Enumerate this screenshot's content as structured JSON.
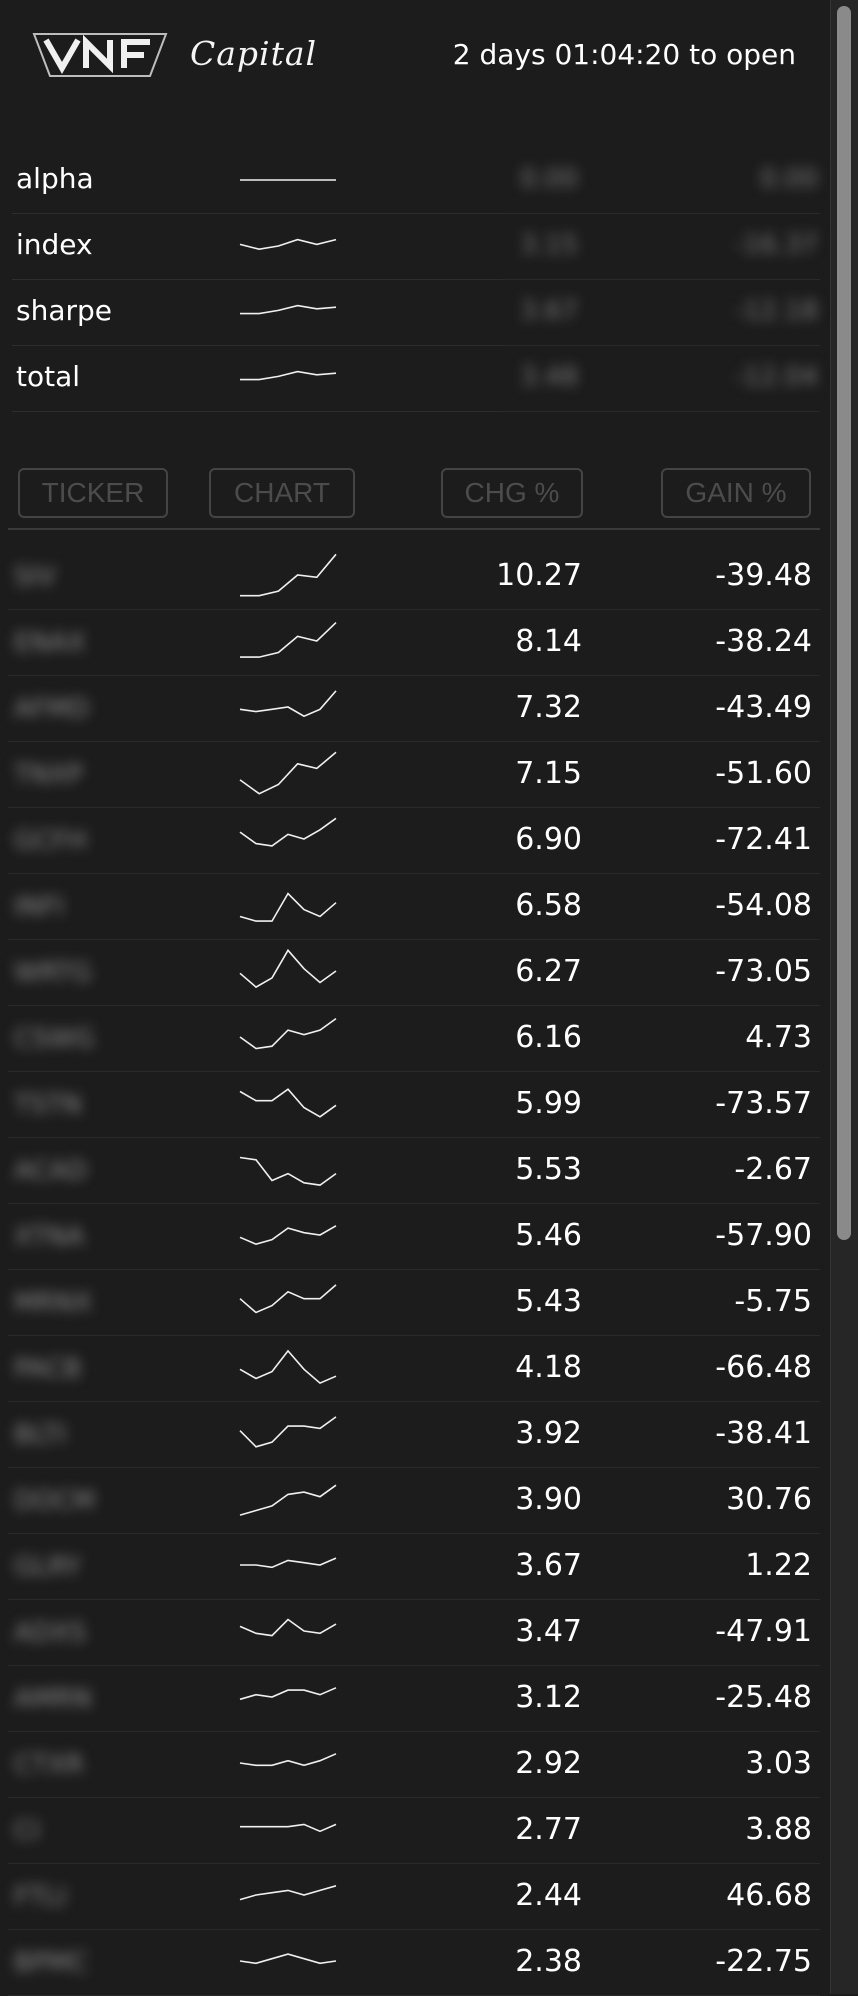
{
  "header": {
    "logo_text": "VNF",
    "logo_script": "Capital",
    "countdown": "2 days 01:04:20 to open"
  },
  "summary": [
    {
      "label": "alpha",
      "value": "0.00",
      "gain": "0.00",
      "spark": [
        0.5,
        0.5,
        0.5,
        0.5,
        0.5,
        0.5
      ]
    },
    {
      "label": "index",
      "value": "3.15",
      "gain": "-16.37",
      "spark": [
        0.45,
        0.6,
        0.5,
        0.3,
        0.45,
        0.3
      ]
    },
    {
      "label": "sharpe",
      "value": "3.67",
      "gain": "-12.18",
      "spark": [
        0.55,
        0.55,
        0.45,
        0.3,
        0.4,
        0.35
      ]
    },
    {
      "label": "total",
      "value": "3.48",
      "gain": "-12.04",
      "spark": [
        0.55,
        0.55,
        0.45,
        0.3,
        0.4,
        0.35
      ]
    }
  ],
  "table": {
    "headers": {
      "ticker": "TICKER",
      "chart": "CHART",
      "chg": "CHG %",
      "gain": "GAIN %"
    },
    "rows": [
      {
        "ticker": "SIV",
        "chg": "10.27",
        "gain": "-39.48",
        "spark": [
          0.95,
          0.95,
          0.85,
          0.5,
          0.55,
          0.05
        ]
      },
      {
        "ticker": "ENAX",
        "chg": "8.14",
        "gain": "-38.24",
        "spark": [
          0.85,
          0.85,
          0.75,
          0.4,
          0.5,
          0.1
        ]
      },
      {
        "ticker": "AFMD",
        "chg": "7.32",
        "gain": "-43.49",
        "spark": [
          0.55,
          0.6,
          0.55,
          0.5,
          0.7,
          0.55,
          0.15
        ]
      },
      {
        "ticker": "TNXP",
        "chg": "7.15",
        "gain": "-51.60",
        "spark": [
          0.65,
          0.95,
          0.75,
          0.3,
          0.4,
          0.05
        ]
      },
      {
        "ticker": "GCFH",
        "chg": "6.90",
        "gain": "-72.41",
        "spark": [
          0.35,
          0.6,
          0.65,
          0.4,
          0.5,
          0.3,
          0.05
        ]
      },
      {
        "ticker": "INFI",
        "chg": "6.58",
        "gain": "-54.08",
        "spark": [
          0.75,
          0.85,
          0.85,
          0.25,
          0.6,
          0.75,
          0.45
        ]
      },
      {
        "ticker": "WRTG",
        "chg": "6.27",
        "gain": "-73.05",
        "spark": [
          0.55,
          0.85,
          0.65,
          0.05,
          0.45,
          0.75,
          0.5
        ]
      },
      {
        "ticker": "CSWG",
        "chg": "6.16",
        "gain": "4.73",
        "spark": [
          0.5,
          0.75,
          0.7,
          0.35,
          0.45,
          0.35,
          0.1
        ]
      },
      {
        "ticker": "TSTN",
        "chg": "5.99",
        "gain": "-73.57",
        "spark": [
          0.25,
          0.45,
          0.45,
          0.2,
          0.6,
          0.8,
          0.55
        ]
      },
      {
        "ticker": "ACAD",
        "chg": "5.53",
        "gain": "-2.67",
        "spark": [
          0.25,
          0.3,
          0.75,
          0.6,
          0.8,
          0.85,
          0.6
        ]
      },
      {
        "ticker": "XTNA",
        "chg": "5.46",
        "gain": "-57.90",
        "spark": [
          0.55,
          0.7,
          0.6,
          0.35,
          0.45,
          0.5,
          0.3
        ]
      },
      {
        "ticker": "MRNX",
        "chg": "5.43",
        "gain": "-5.75",
        "spark": [
          0.45,
          0.75,
          0.6,
          0.3,
          0.45,
          0.45,
          0.15
        ]
      },
      {
        "ticker": "PACB",
        "chg": "4.18",
        "gain": "-66.48",
        "spark": [
          0.55,
          0.75,
          0.6,
          0.15,
          0.55,
          0.85,
          0.7
        ]
      },
      {
        "ticker": "BLTI",
        "chg": "3.92",
        "gain": "-38.41",
        "spark": [
          0.45,
          0.8,
          0.7,
          0.35,
          0.35,
          0.4,
          0.15
        ]
      },
      {
        "ticker": "DOCM",
        "chg": "3.90",
        "gain": "30.76",
        "spark": [
          0.85,
          0.75,
          0.65,
          0.4,
          0.35,
          0.45,
          0.2
        ]
      },
      {
        "ticker": "GLRY",
        "chg": "3.67",
        "gain": "1.22",
        "spark": [
          0.5,
          0.5,
          0.55,
          0.4,
          0.45,
          0.5,
          0.35
        ]
      },
      {
        "ticker": "ADXS",
        "chg": "3.47",
        "gain": "-47.91",
        "spark": [
          0.4,
          0.55,
          0.6,
          0.25,
          0.5,
          0.55,
          0.35
        ]
      },
      {
        "ticker": "AMRN",
        "chg": "3.12",
        "gain": "-25.48",
        "spark": [
          0.55,
          0.45,
          0.5,
          0.35,
          0.35,
          0.45,
          0.3
        ]
      },
      {
        "ticker": "CTXR",
        "chg": "2.92",
        "gain": "3.03",
        "spark": [
          0.5,
          0.55,
          0.55,
          0.45,
          0.55,
          0.45,
          0.3
        ]
      },
      {
        "ticker": "CI",
        "chg": "2.77",
        "gain": "3.88",
        "spark": [
          0.45,
          0.45,
          0.45,
          0.45,
          0.4,
          0.55,
          0.4
        ]
      },
      {
        "ticker": "FTLI",
        "chg": "2.44",
        "gain": "46.68",
        "spark": [
          0.6,
          0.5,
          0.45,
          0.4,
          0.5,
          0.4,
          0.3
        ]
      },
      {
        "ticker": "BPMC",
        "chg": "2.38",
        "gain": "-22.75",
        "spark": [
          0.5,
          0.55,
          0.45,
          0.35,
          0.45,
          0.55,
          0.5
        ]
      }
    ]
  }
}
